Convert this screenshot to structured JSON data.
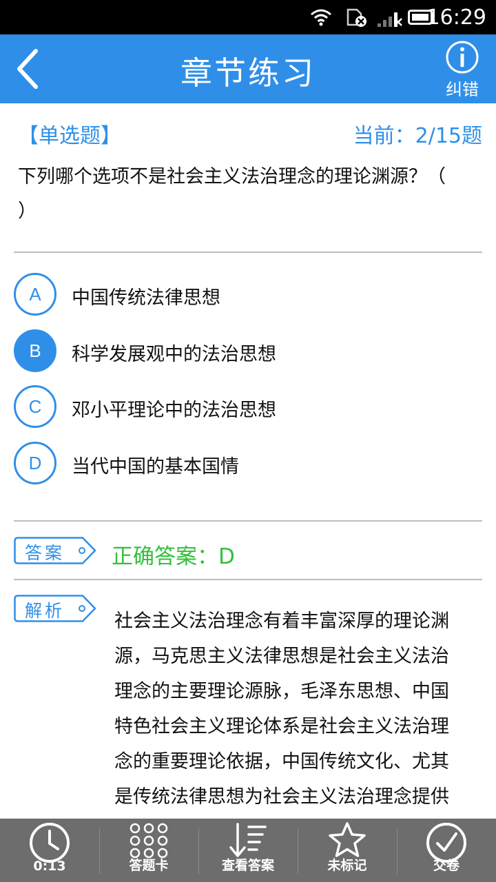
{
  "status_bar": {
    "time": "16:29",
    "icons": [
      "wifi-icon",
      "sim-off-icon",
      "signal-icon",
      "battery-icon"
    ]
  },
  "header": {
    "title": "章节练习",
    "report_label": "纠错",
    "background": "#2f8fe8"
  },
  "question": {
    "type_label": "【单选题】",
    "progress": "当前：2/15题",
    "text": "下列哪个选项不是社会主义法治理念的理论渊源？（　 ）"
  },
  "options": [
    {
      "letter": "A",
      "text": "中国传统法律思想",
      "selected": false
    },
    {
      "letter": "B",
      "text": "科学发展观中的法治思想",
      "selected": true
    },
    {
      "letter": "C",
      "text": "邓小平理论中的法治思想",
      "selected": false
    },
    {
      "letter": "D",
      "text": "当代中国的基本国情",
      "selected": false
    }
  ],
  "answer": {
    "tag": "答案",
    "text": "正确答案：D",
    "color": "#31c13b"
  },
  "analysis": {
    "tag": "解析",
    "text": "社会主义法治理念有着丰富深厚的理论渊源，马克思主义法律思想是社会主义法治理念的主要理论源脉，毛泽东思想、中国特色社会主义理论体系是社会主义法治理念的重要理论依据，中国传统文化、尤其是传统法律思想为社会主义法治理念提供"
  },
  "toolbar": {
    "timer": "0:13",
    "answer_card": "答题卡",
    "view_answer": "查看答案",
    "unmarked": "未标记",
    "submit": "交卷"
  },
  "colors": {
    "accent": "#2f8fe8",
    "toolbar": "#6d6d6d",
    "correct": "#31c13b"
  }
}
